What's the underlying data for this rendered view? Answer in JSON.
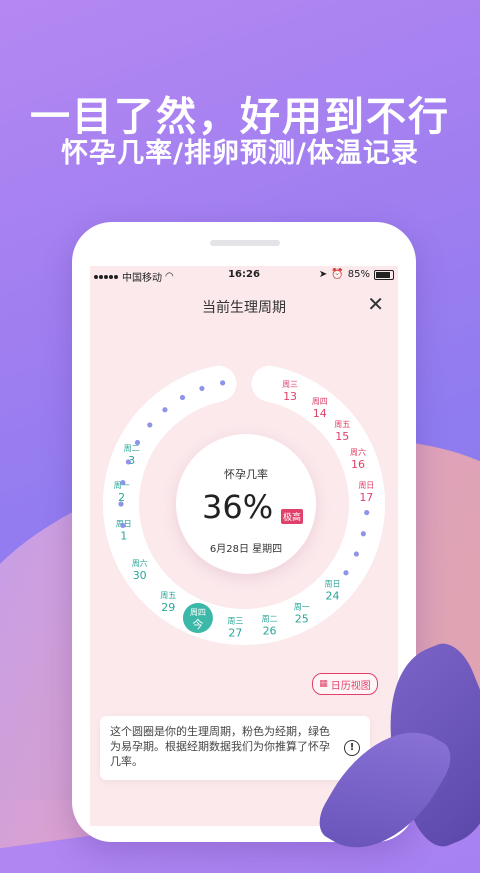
{
  "headline": "一目了然，好用到不行",
  "subline": "怀孕几率/排卵预测/体温记录",
  "status": {
    "carrier": "中国移动",
    "time": "16:26",
    "battery": "85%",
    "battery_level": 0.85
  },
  "header": {
    "title": "当前生理周期",
    "close_icon": "close-icon"
  },
  "ring": {
    "days": [
      {
        "week": "周三",
        "date": "13",
        "type": "period"
      },
      {
        "week": "周四",
        "date": "14",
        "type": "period"
      },
      {
        "week": "周五",
        "date": "15",
        "type": "period"
      },
      {
        "week": "周六",
        "date": "16",
        "type": "period"
      },
      {
        "week": "周日",
        "date": "17",
        "type": "period"
      },
      {
        "week": "周一",
        "date": "25",
        "type": "fertile"
      },
      {
        "week": "周二",
        "date": "26",
        "type": "fertile"
      },
      {
        "week": "周三",
        "date": "27",
        "type": "fertile"
      },
      {
        "week": "周四",
        "date": "今",
        "type": "today"
      },
      {
        "week": "周五",
        "date": "29",
        "type": "fertile"
      },
      {
        "week": "周六",
        "date": "30",
        "type": "fertile"
      },
      {
        "week": "周日",
        "date": "1",
        "type": "fertile"
      },
      {
        "week": "周一",
        "date": "2",
        "type": "fertile"
      },
      {
        "week": "周二",
        "date": "3",
        "type": "fertile"
      },
      {
        "week": "周日",
        "date": "24",
        "type": "fertile"
      }
    ],
    "colors": {
      "period": "#e0416a",
      "fertile": "#2aa69a",
      "dot": "#8e95e8",
      "ring": "#ffffff",
      "today": "#3cb8a9"
    }
  },
  "center": {
    "label": "怀孕几率",
    "value": "36%",
    "badge": "极高",
    "date": "6月28日 星期四"
  },
  "calendar_button": {
    "label": "日历视图",
    "icon": "calendar-icon"
  },
  "info": {
    "text": "这个圆圈是你的生理周期，粉色为经期，绿色为易孕期。根据经期数据我们为你推算了怀孕几率。",
    "icon": "info-icon"
  }
}
